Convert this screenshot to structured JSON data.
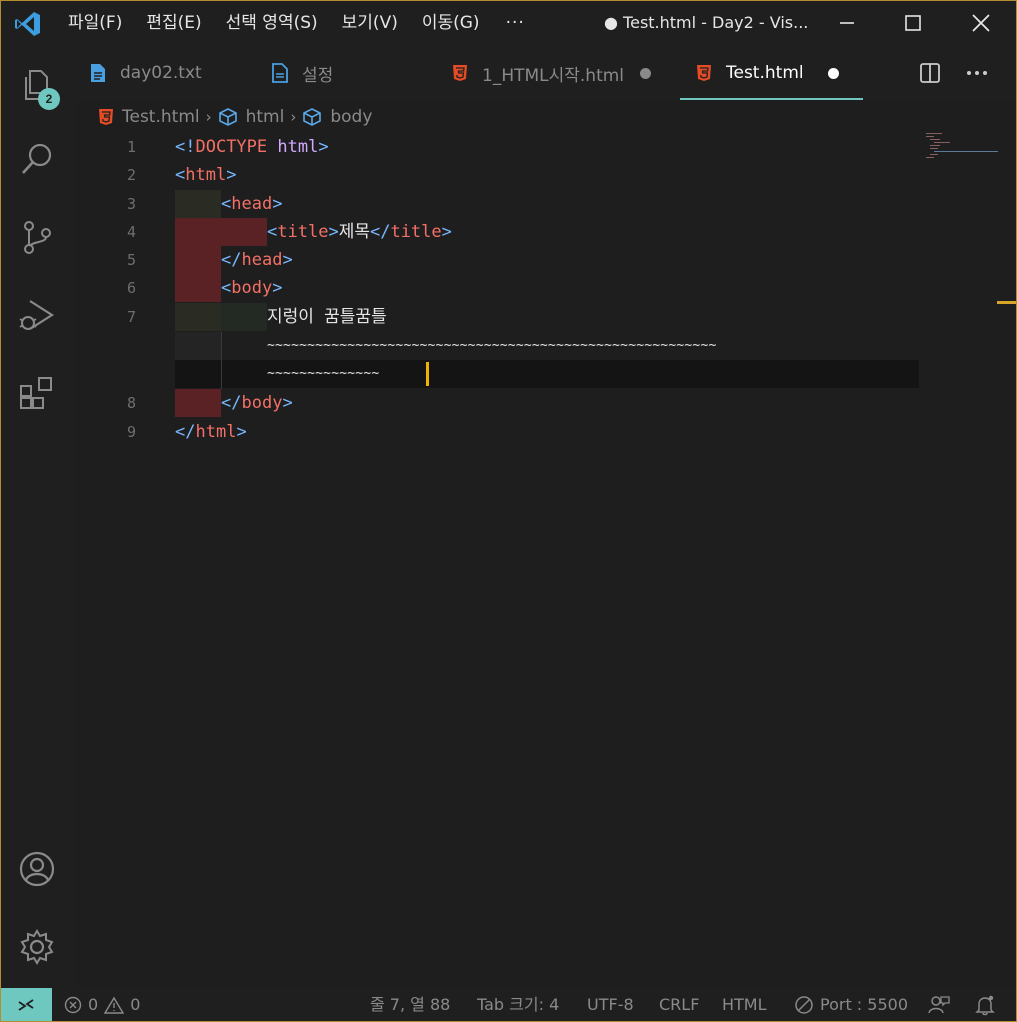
{
  "menubar": {
    "items": [
      "파일(F)",
      "편집(E)",
      "선택 영역(S)",
      "보기(V)",
      "이동(G)"
    ],
    "more": "···"
  },
  "window": {
    "title": "● Test.html - Day2 - Vis..."
  },
  "activity": {
    "explorer_badge": "2"
  },
  "tabs": [
    {
      "label": "day02.txt",
      "icon": "file-text-icon"
    },
    {
      "label": "설정",
      "icon": "file-icon"
    },
    {
      "label": "1_HTML시작.html",
      "icon": "html5-icon",
      "dirty": true
    },
    {
      "label": "Test.html",
      "icon": "html5-icon",
      "dirty": true,
      "active": true
    }
  ],
  "breadcrumb": {
    "file": "Test.html",
    "items": [
      "html",
      "body"
    ]
  },
  "editor": {
    "line_numbers": [
      "1",
      "2",
      "3",
      "4",
      "5",
      "6",
      "7",
      "8",
      "9"
    ],
    "lines": {
      "l1": {
        "open": "<!",
        "kw": "DOCTYPE",
        "attr": "html",
        "close": ">"
      },
      "l2": {
        "o": "<",
        "t": "html",
        "c": ">"
      },
      "l3": {
        "o": "<",
        "t": "head",
        "c": ">"
      },
      "l4": {
        "o": "<",
        "t": "title",
        "c": ">",
        "text": "제목",
        "o2": "</",
        "t2": "title",
        "c2": ">"
      },
      "l5": {
        "o": "</",
        "t": "head",
        "c": ">"
      },
      "l6": {
        "o": "<",
        "t": "body",
        "c": ">"
      },
      "l7": {
        "text": "지렁이 꿈틀꿈틀"
      },
      "l7b": {
        "text": "~~~~~~~~~~~~~~~~~~~~~~~~~~~~~~~~~~~~~~~~~~~~~~~~~~~~~~~~"
      },
      "l7c": {
        "text": "~~~~~~~~~~~~~~"
      },
      "l8": {
        "o": "</",
        "t": "body",
        "c": ">"
      },
      "l9": {
        "o": "</",
        "t": "html",
        "c": ">"
      }
    }
  },
  "statusbar": {
    "errors": "0",
    "warnings": "0",
    "position": "줄 7, 열 88",
    "tab_size": "Tab 크기: 4",
    "encoding": "UTF-8",
    "eol": "CRLF",
    "language": "HTML",
    "port": "Port : 5500"
  },
  "colors": {
    "accent": "#6ec8c0",
    "caret": "#f0b400",
    "tag": "#f47067",
    "bracket": "#79b8ff"
  }
}
